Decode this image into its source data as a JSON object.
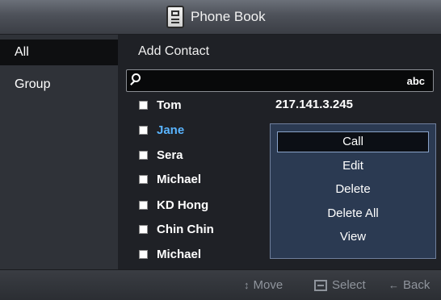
{
  "title": {
    "icon": "phone-book-icon",
    "label": "Phone Book"
  },
  "sidebar": {
    "items": [
      {
        "label": "All",
        "active": true
      },
      {
        "label": "Group",
        "active": false
      }
    ]
  },
  "main": {
    "add_contact_label": "Add Contact",
    "search": {
      "value": "",
      "placeholder": "",
      "mode": "abc",
      "icon": "search-icon"
    },
    "contacts": [
      {
        "name": "Tom",
        "selected": false
      },
      {
        "name": "Jane",
        "selected": true
      },
      {
        "name": "Sera",
        "selected": false
      },
      {
        "name": "Michael",
        "selected": false
      },
      {
        "name": "KD Hong",
        "selected": false
      },
      {
        "name": "Chin Chin",
        "selected": false
      },
      {
        "name": "Michael",
        "selected": false
      }
    ],
    "detail_value": "217.141.3.245"
  },
  "context_menu": {
    "items": [
      {
        "label": "Call",
        "active": true
      },
      {
        "label": "Edit",
        "active": false
      },
      {
        "label": "Delete",
        "active": false
      },
      {
        "label": "Delete All",
        "active": false
      },
      {
        "label": "View",
        "active": false
      }
    ]
  },
  "bottom_bar": {
    "move_label": "Move",
    "select_label": "Select",
    "back_label": "Back"
  },
  "colors": {
    "selected_contact": "#59b4ff",
    "menu_bg": "#2b3a52"
  }
}
